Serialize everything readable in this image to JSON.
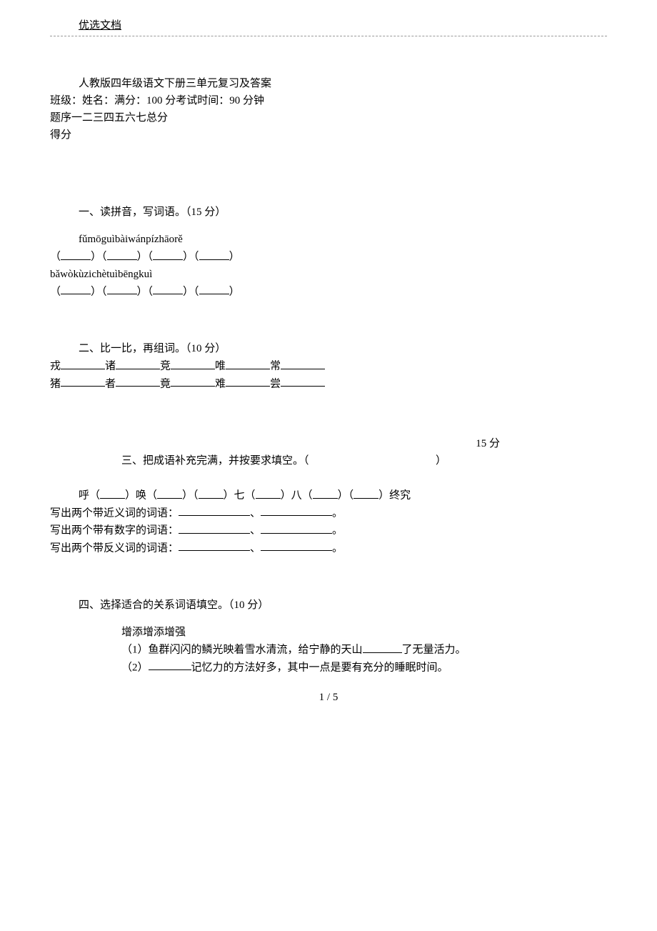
{
  "header": {
    "label": "优选文档"
  },
  "title": "人教版四年级语文下册三单元复习及答案",
  "meta_line": "班级：姓名：满分：100 分考试时间：90 分钟",
  "seq_line": "题序一二三四五六七总分",
  "score_line": "得分",
  "q1": {
    "title": "一、读拼音，写词语。（15 分）",
    "pinyin1": "fǔmōguìbàiwánpízhāorě",
    "pinyin2": "bǎwòkùzichètuìbēngkuì"
  },
  "q2": {
    "title": "二、比一比，再组词。（10 分）",
    "row1": {
      "c1": "戎",
      "c2": "诸",
      "c3": "竞",
      "c4": "唯",
      "c5": "常"
    },
    "row2": {
      "c1": "猪",
      "c2": "者",
      "c3": "竟",
      "c4": "难",
      "c5": "尝"
    }
  },
  "q3": {
    "score": "15 分",
    "title_a": "三、把成语补充完满，并按要求填空。（",
    "title_b": "）",
    "fill_a": "呼（",
    "fill_b": "）唤（",
    "fill_c": "）（",
    "fill_d": "）七（",
    "fill_e": "）八（",
    "fill_f": "）（",
    "fill_g": "）终究",
    "line1": "写出两个带近义词的词语：",
    "line2": "写出两个带有数字的词语：",
    "line3": "写出两个带反义词的词语：",
    "sep": "、",
    "end": "。"
  },
  "q4": {
    "title": "四、选择适合的关系词语填空。（10 分）",
    "words": "增添增添增强",
    "s1a": "（1）鱼群闪闪的鳞光映着雪水清流，给宁静的天山",
    "s1b": "了无量活力。",
    "s2a": "（2）",
    "s2b": "记忆力的方法好多，其中一点是要有充分的睡眠时间。"
  },
  "page_num": "1 / 5"
}
